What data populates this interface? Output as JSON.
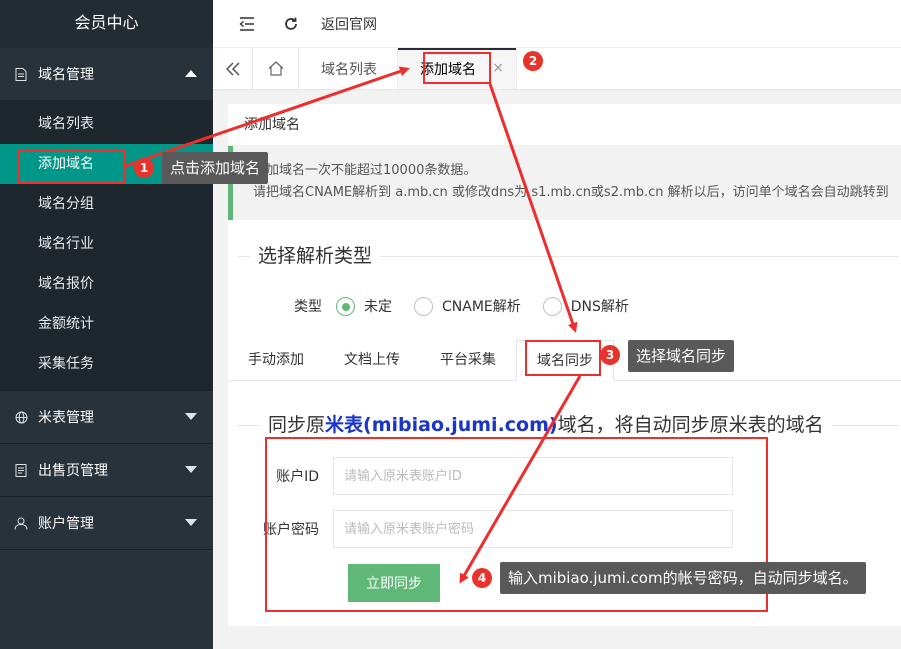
{
  "sidebar": {
    "title": "会员中心",
    "groups": [
      {
        "label": "域名管理",
        "icon": "document-icon",
        "expanded": true,
        "items": [
          "域名列表",
          "添加域名",
          "域名分组",
          "域名行业",
          "域名报价",
          "金额统计",
          "采集任务"
        ]
      },
      {
        "label": "米表管理",
        "icon": "globe-icon",
        "expanded": false
      },
      {
        "label": "出售页管理",
        "icon": "page-icon",
        "expanded": false
      },
      {
        "label": "账户管理",
        "icon": "user-icon",
        "expanded": false
      }
    ]
  },
  "topbar": {
    "back_label": "返回官网"
  },
  "tabs": {
    "list": "域名列表",
    "add": "添加域名",
    "close": "×"
  },
  "card": {
    "title": "添加域名",
    "notice_line1": "添加域名一次不能超过10000条数据。",
    "notice_line2": "请把域名CNAME解析到 a.mb.cn 或修改dns为 s1.mb.cn或s2.mb.cn 解析以后，访问单个域名会自动跳转到",
    "section_title": "选择解析类型",
    "type_label": "类型",
    "radios": [
      "未定",
      "CNAME解析",
      "DNS解析"
    ],
    "subtabs": [
      "手动添加",
      "文档上传",
      "平台采集",
      "域名同步"
    ],
    "sync_prefix": "同步原",
    "sync_highlight": "米表(mibiao.jumi.com)",
    "sync_suffix": "域名，将自动同步原米表的域名",
    "account_label": "账户ID",
    "account_placeholder": "请输入原米表账户ID",
    "password_label": "账户密码",
    "password_placeholder": "请输入原米表账户密码",
    "submit_label": "立即同步"
  },
  "annotations": {
    "b1": "1",
    "t1": "点击添加域名",
    "b2": "2",
    "b3": "3",
    "t3": "选择域名同步",
    "b4": "4",
    "t4": "输入mibiao.jumi.com的帐号密码，自动同步域名。"
  },
  "colors": {
    "sidebar": "#28323b",
    "active": "#009688",
    "green": "#5fb878",
    "annotation": "#ee2d2d"
  }
}
